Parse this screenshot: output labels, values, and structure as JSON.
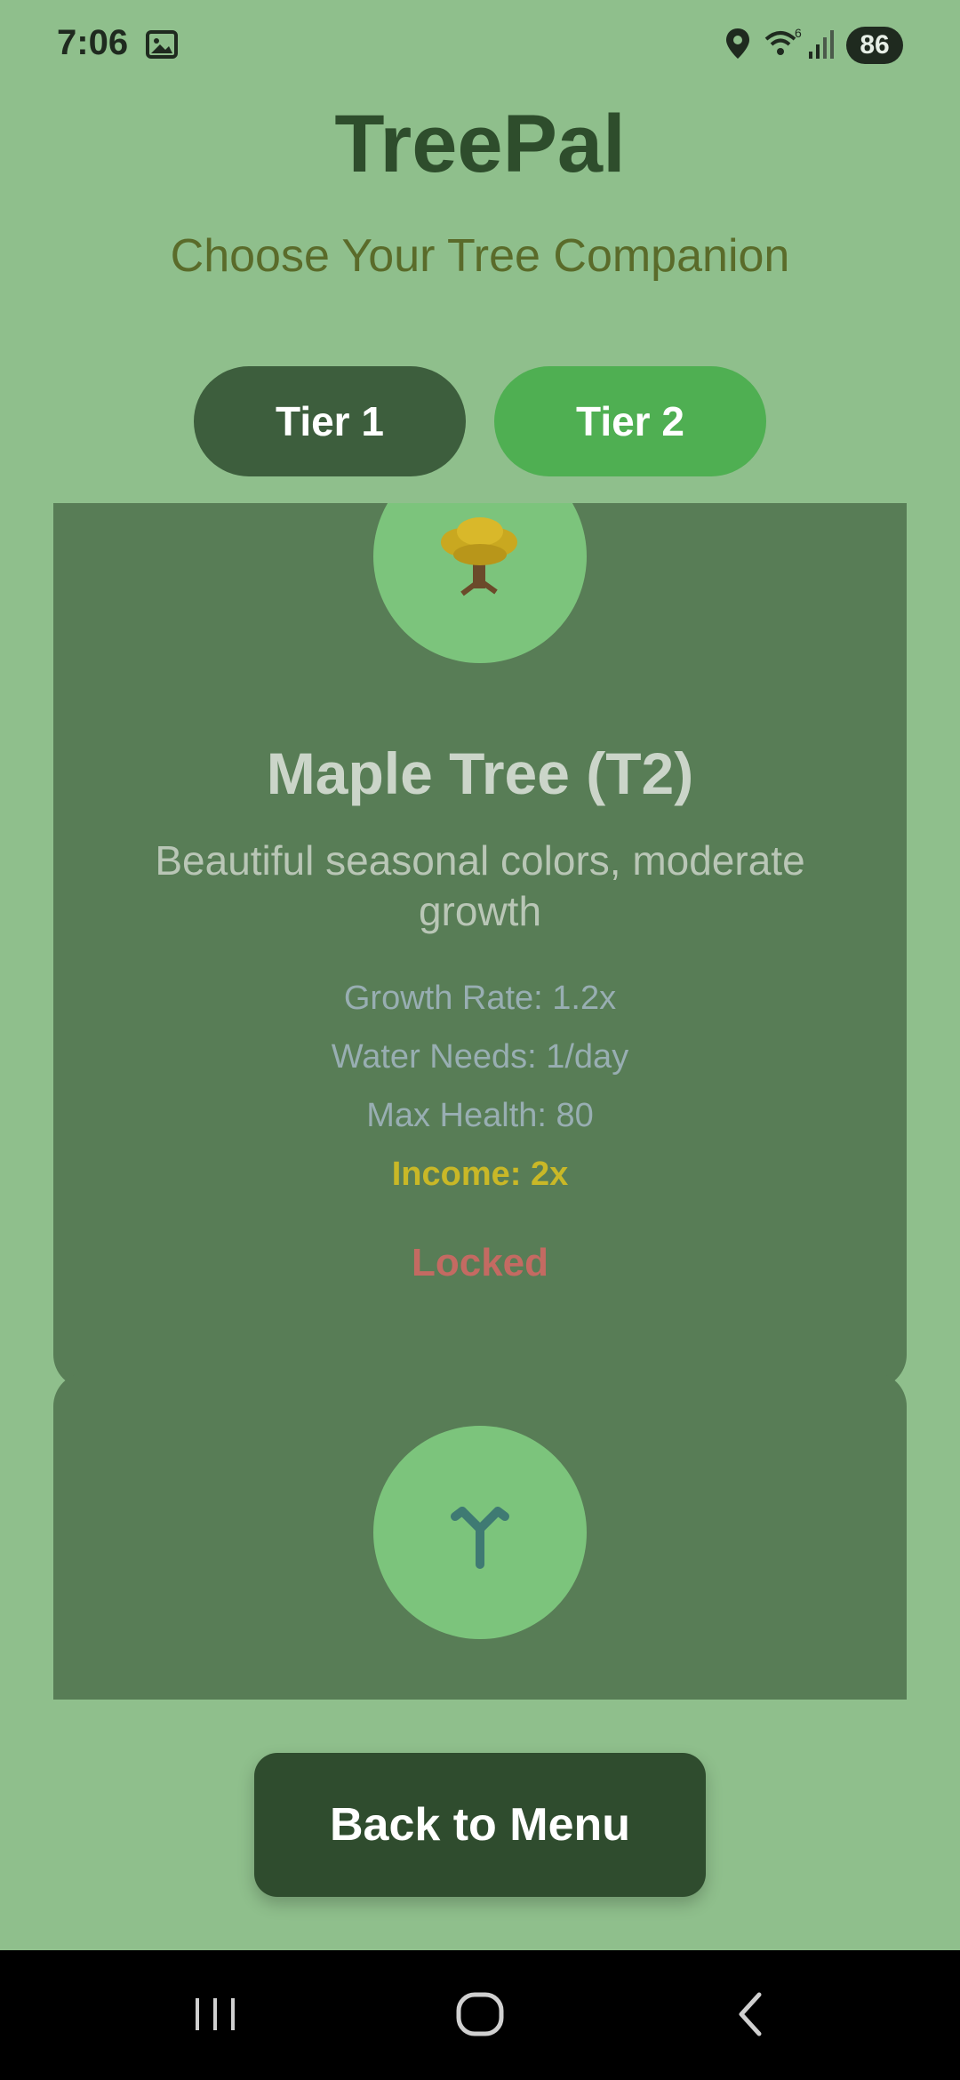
{
  "status_bar": {
    "time": "7:06",
    "battery": "86",
    "icons": [
      "screenshot-icon",
      "location-icon",
      "wifi-icon",
      "signal-icon",
      "battery-icon"
    ]
  },
  "header": {
    "title": "TreePal",
    "subtitle": "Choose Your Tree Companion"
  },
  "tabs": [
    {
      "label": "Tier 1",
      "selected": false
    },
    {
      "label": "Tier 2",
      "selected": true
    }
  ],
  "cards": [
    {
      "name": "Maple Tree (T2)",
      "description": "Beautiful seasonal colors, moderate growth",
      "growth_rate": "Growth Rate: 1.2x",
      "water_needs": "Water Needs: 1/day",
      "max_health": "Max Health: 80",
      "income": "Income: 2x",
      "status": "Locked",
      "icon": "maple-tree-icon"
    },
    {
      "name": "",
      "icon": "sapling-tree-icon"
    }
  ],
  "back_button": {
    "label": "Back to Menu"
  },
  "nav_bar": {
    "icons": [
      "recent-apps-icon",
      "home-icon",
      "back-icon"
    ]
  },
  "colors": {
    "background": "#8fbf8c",
    "title": "#2e4d2c",
    "subtitle": "#5a6b2a",
    "tab_inactive": "#3d5e3d",
    "tab_active": "#4faf52",
    "card": "#587d56",
    "tree_circle": "#7cc47c",
    "income": "#c9b827",
    "locked": "#c46a62",
    "button": "#2f4c2e"
  }
}
